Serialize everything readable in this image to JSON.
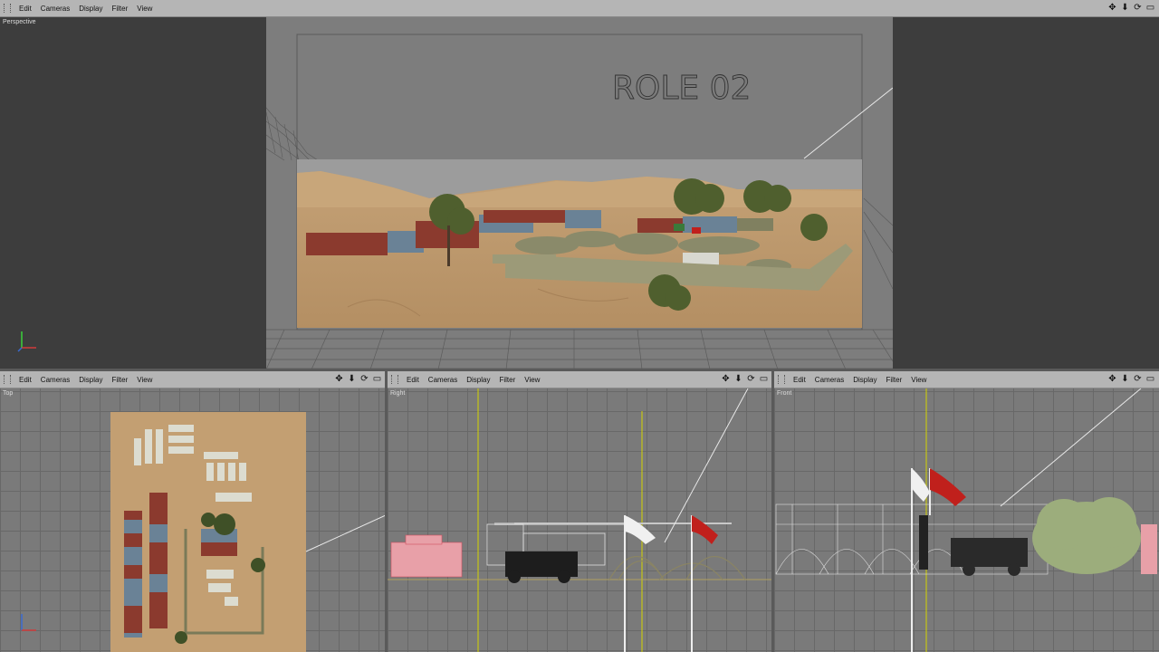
{
  "menu": {
    "items": [
      "Edit",
      "Cameras",
      "Display",
      "Filter",
      "View"
    ]
  },
  "viewports": {
    "perspective": {
      "label": "Perspective"
    },
    "top": {
      "label": "Top"
    },
    "right": {
      "label": "Right"
    },
    "front": {
      "label": "Front"
    }
  },
  "scene": {
    "title_text": "ROLE 02"
  },
  "icons": {
    "move": "move-icon",
    "down": "arrow-down-icon",
    "rotate": "rotate-icon",
    "maximize": "maximize-icon"
  },
  "colors": {
    "menubar": "#b5b5b5",
    "viewport_dark": "#3d3d3d",
    "viewport_grid": "#7a7a7a",
    "sand": "#c9a67a",
    "container_red": "#8b3a2e",
    "container_blue": "#6a8296",
    "flag_red": "#c0201c",
    "guide_yellow": "#d4d400"
  }
}
